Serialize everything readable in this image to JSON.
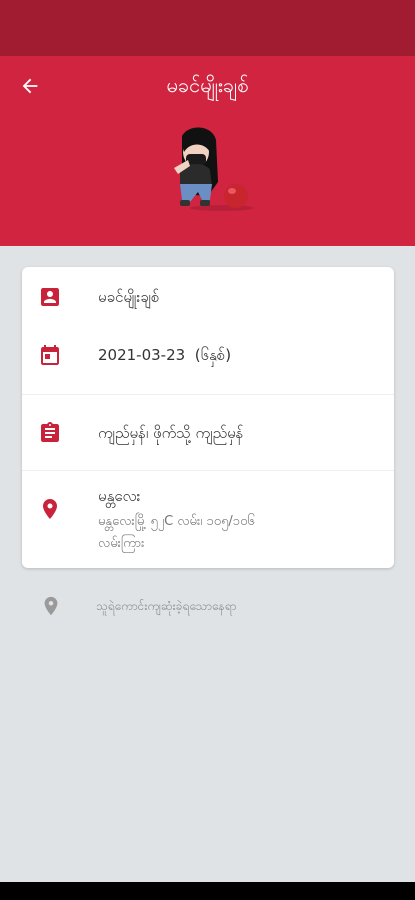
{
  "header": {
    "title": "မခင်မျိုးချစ်"
  },
  "colors": {
    "primary": "#d02440",
    "primary_dark": "#a11c31",
    "background": "#dfe3e5"
  },
  "icons": {
    "back": "arrow-left-icon",
    "person": "person-badge-icon",
    "calendar": "calendar-icon",
    "clipboard": "clipboard-icon",
    "location": "location-pin-icon"
  },
  "profile": {
    "name": "မခင်မျိုးချစ်",
    "date": "2021-03-23",
    "age": "(၆နှစ်)",
    "tags": "ကျည်မှန်၊ ဖိုက်သို့ ကျည်မှန်",
    "city": "မန္တလေး",
    "address_line1": "မန္တလေးမြို့ ၅၂C လမ်း၊ ၁၀၅/၁၀၆",
    "address_line2": "လမ်းကြား"
  },
  "extra_location": {
    "label": "သူရဲကောင်းကျဆုံးခဲ့ရသောနေရာ"
  }
}
